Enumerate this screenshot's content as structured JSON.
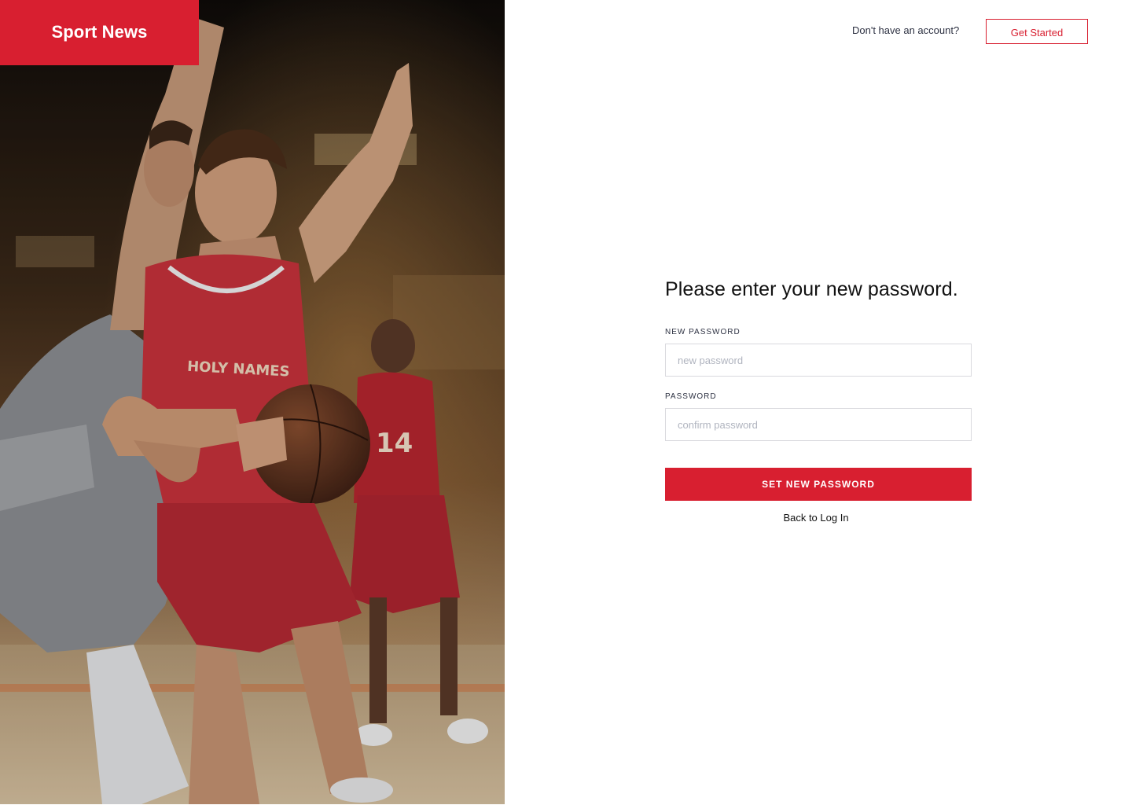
{
  "brand": {
    "name": "Sport News",
    "color": "#d81f30"
  },
  "topbar": {
    "prompt": "Don't have an account?",
    "cta_label": "Get Started"
  },
  "hero": {
    "jersey_text": "HOLY NAMES",
    "jersey_number": "14"
  },
  "form": {
    "title": "Please enter your new password.",
    "new_password": {
      "label": "NEW PASSWORD",
      "placeholder": "new password",
      "value": ""
    },
    "confirm_password": {
      "label": "PASSWORD",
      "placeholder": "confirm password",
      "value": ""
    },
    "submit_label": "SET NEW PASSWORD",
    "back_link": "Back to Log In"
  }
}
